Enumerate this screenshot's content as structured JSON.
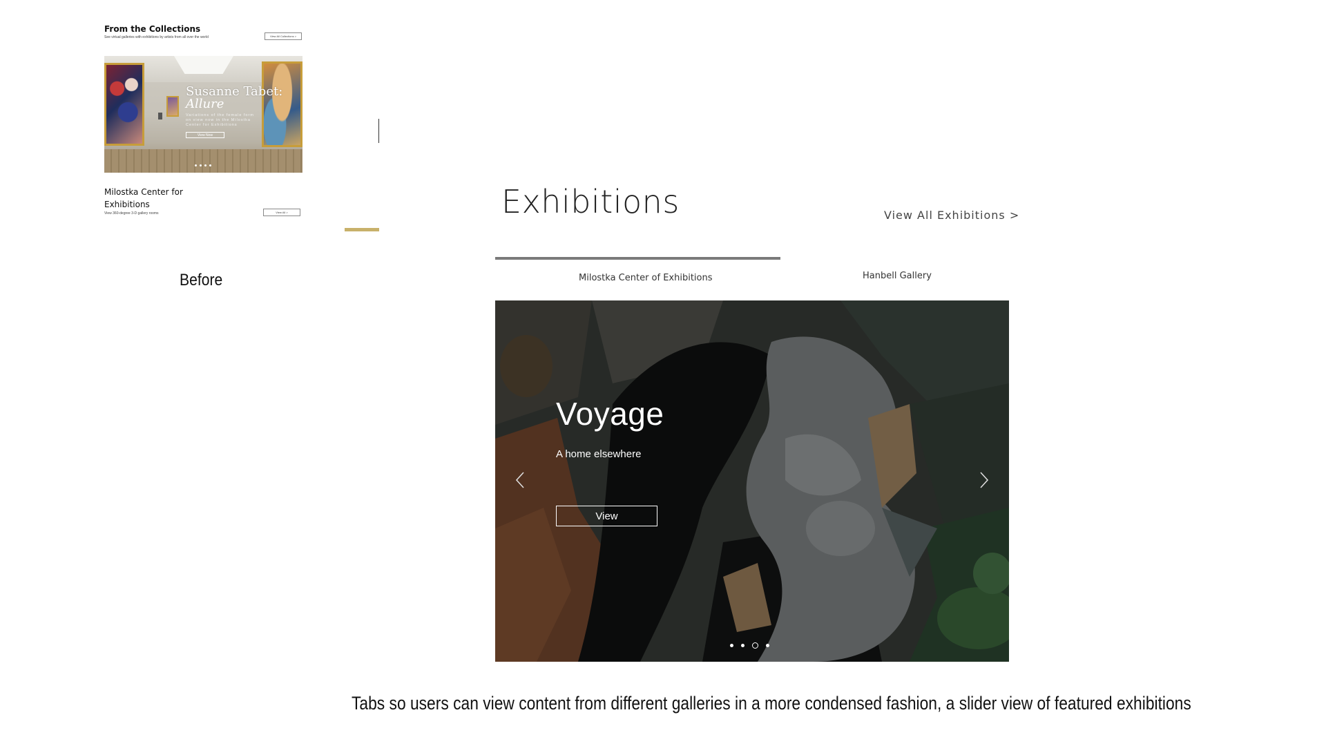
{
  "before": {
    "section_title": "From the Collections",
    "section_subtitle": "See virtual galleries with exhibitions by artists from all over the world",
    "view_all_collections_label": "View All Collections >",
    "hero": {
      "artist": "Susanne Tabet:",
      "show": "Allure",
      "description": "Variations of the female form on view now in the Milostka Center for Exhibitions",
      "button_label": "View Now"
    },
    "gallery_title": "Milostka Center for Exhibitions",
    "gallery_subtitle": "View 360-degree 3-D gallery rooms",
    "gallery_button_label": "View All >",
    "label": "Before"
  },
  "after": {
    "title": "Exhibitions",
    "view_all_label": "View All Exhibitions >",
    "tabs": [
      {
        "label": "Milostka Center of Exhibitions",
        "active": true
      },
      {
        "label": "Hanbell Gallery",
        "active": false
      }
    ],
    "slide": {
      "title": "Voyage",
      "subtitle": "A home elsewhere",
      "button_label": "View",
      "dot_count": 4,
      "active_dot": 3
    }
  },
  "caption": "Tabs so users can view content from different galleries in a more condensed fashion, a slider view of featured exhibitions",
  "colors": {
    "tab_underline": "#7a7a7a",
    "accent_gold": "#c8b16a",
    "slider_overlay": "#3d3a36"
  }
}
